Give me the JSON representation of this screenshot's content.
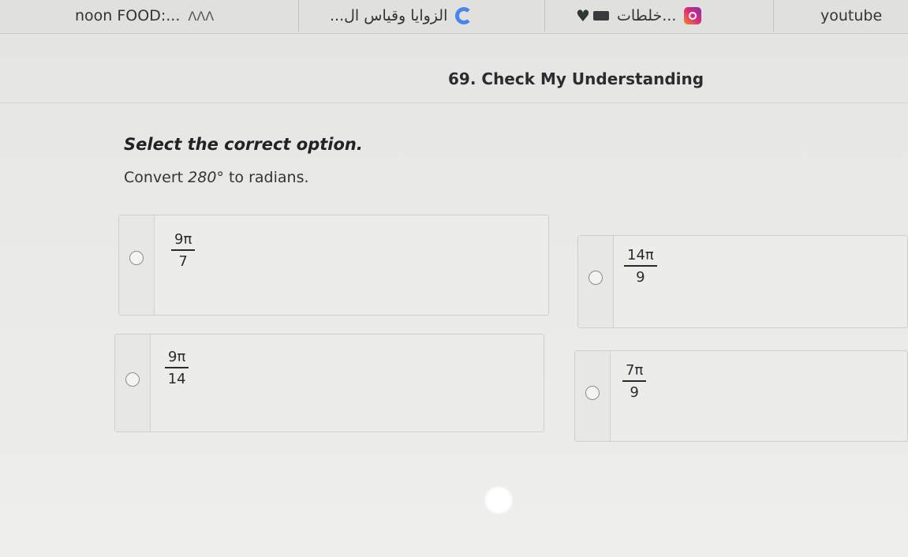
{
  "tabs": [
    {
      "label": "noon FOOD:...",
      "extra": "ᐱᐱᐱ"
    },
    {
      "label": "...الزوايا وقياس ال"
    },
    {
      "label": "خلطات..."
    },
    {
      "label": "youtube"
    }
  ],
  "question": {
    "title": "69. Check My Understanding",
    "instruction": "Select the correct option.",
    "prompt_before": "Convert ",
    "prompt_degree": "280°",
    "prompt_after": " to radians."
  },
  "options": [
    {
      "numerator": "9π",
      "denominator": "7"
    },
    {
      "numerator": "14π",
      "denominator": "9"
    },
    {
      "numerator": "9π",
      "denominator": "14"
    },
    {
      "numerator": "7π",
      "denominator": "9"
    }
  ]
}
